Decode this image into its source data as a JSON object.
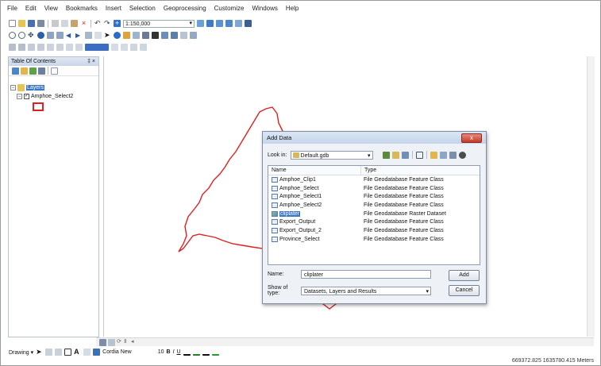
{
  "menu": [
    "File",
    "Edit",
    "View",
    "Bookmarks",
    "Insert",
    "Selection",
    "Geoprocessing",
    "Customize",
    "Windows",
    "Help"
  ],
  "toolbar": {
    "scale_value": "1:150,000"
  },
  "toc": {
    "title": "Table Of Contents",
    "pin": "‡ ×",
    "layers_label": "Layers",
    "layer_name": "Amphoe_Select2"
  },
  "drawing_bar": {
    "drawing_label": "Drawing ▾",
    "font_name": "Cordia New",
    "font_size": "10",
    "bold": "B",
    "italic": "I",
    "underline": "U"
  },
  "status": {
    "coords": "669372.825  1635780.415 Meters"
  },
  "dialog": {
    "title": "Add Data",
    "look_in_label": "Look in:",
    "look_in_value": "Default.gdb",
    "col_name": "Name",
    "col_type": "Type",
    "items": [
      {
        "name": "Amphoe_Clip1",
        "type": "File Geodatabase Feature Class",
        "kind": "fc"
      },
      {
        "name": "Amphoe_Select",
        "type": "File Geodatabase Feature Class",
        "kind": "fc"
      },
      {
        "name": "Amphoe_Select1",
        "type": "File Geodatabase Feature Class",
        "kind": "fc"
      },
      {
        "name": "Amphoe_Select2",
        "type": "File Geodatabase Feature Class",
        "kind": "fc"
      },
      {
        "name": "cliplater",
        "type": "File Geodatabase Raster Dataset",
        "kind": "raster",
        "selected": true
      },
      {
        "name": "Export_Output",
        "type": "File Geodatabase Feature Class",
        "kind": "fc"
      },
      {
        "name": "Export_Output_2",
        "type": "File Geodatabase Feature Class",
        "kind": "fc"
      },
      {
        "name": "Province_Select",
        "type": "File Geodatabase Feature Class",
        "kind": "fc"
      }
    ],
    "name_label": "Name:",
    "name_value": "cliplater",
    "show_type_label": "Show of type:",
    "show_type_value": "Datasets, Layers and Results",
    "add_label": "Add",
    "cancel_label": "Cancel",
    "close_glyph": "x"
  },
  "colors": {
    "polygon_outline": "#e02020",
    "selection": "#3a78c6",
    "toc_header": "#c9d6e8"
  }
}
